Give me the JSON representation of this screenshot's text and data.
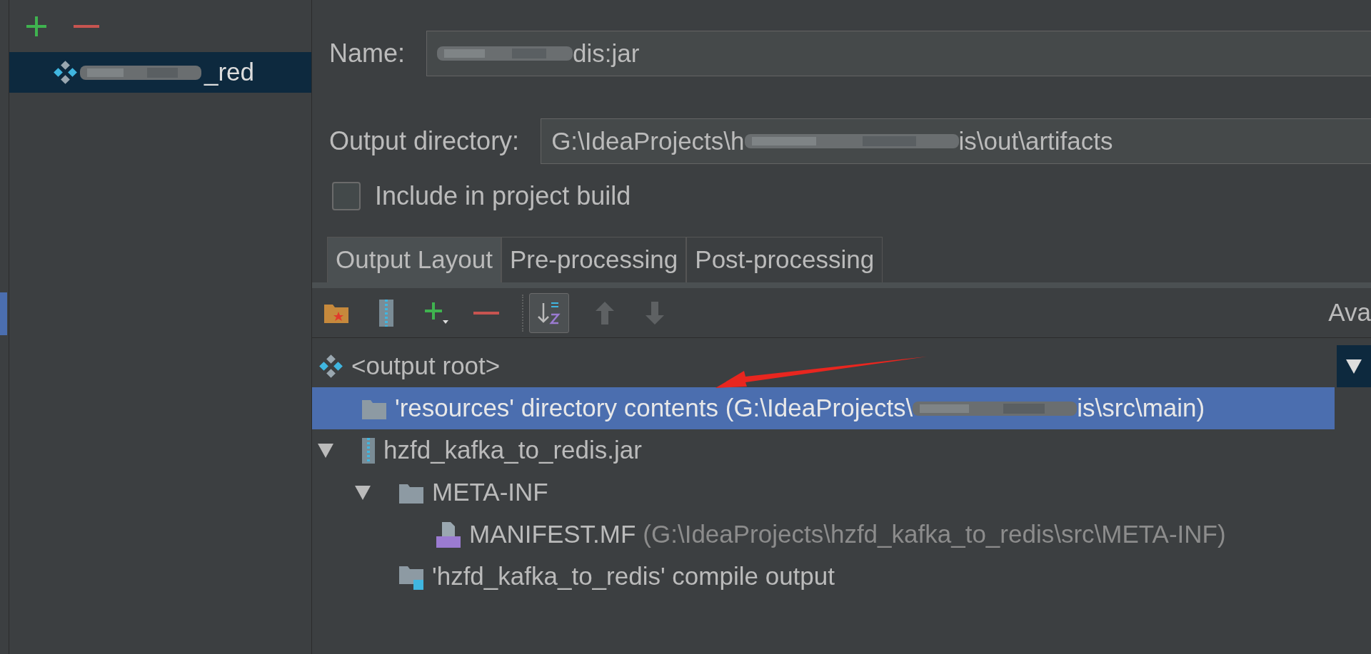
{
  "sidebar": {
    "toolbar": [
      {
        "kind": "add"
      },
      {
        "kind": "remove"
      }
    ],
    "items": [
      {
        "segments": [
          {
            "kind": "blurred"
          },
          {
            "kind": "text",
            "text": "_red"
          }
        ],
        "selected": true
      }
    ]
  },
  "name_field": {
    "label": "Name:",
    "segments": [
      {
        "kind": "blurred"
      },
      {
        "kind": "text",
        "text": "dis:jar"
      }
    ]
  },
  "output_directory": {
    "label": "Output directory:",
    "segments": [
      {
        "kind": "text",
        "text": "G:\\IdeaProjects\\h"
      },
      {
        "kind": "blurred"
      },
      {
        "kind": "text",
        "text": "is\\out\\artifacts"
      }
    ]
  },
  "include_in_build": {
    "label": "Include in project build",
    "checked": false
  },
  "tabs": [
    {
      "label": "Output Layout",
      "selected": true
    },
    {
      "label": "Pre-processing",
      "selected": false
    },
    {
      "label": "Post-processing",
      "selected": false
    }
  ],
  "layout_toolbar": [
    {
      "kind": "new-folder",
      "disabled": false
    },
    {
      "kind": "archive",
      "disabled": false
    },
    {
      "kind": "add",
      "disabled": false
    },
    {
      "kind": "remove",
      "disabled": false
    },
    {
      "kind": "sort",
      "pressed": true,
      "disabled": false
    },
    {
      "kind": "up",
      "disabled": true
    },
    {
      "kind": "down",
      "disabled": true
    }
  ],
  "available_label": "Ava",
  "tree": [
    {
      "kind": "root",
      "segments": [
        {
          "kind": "text",
          "text": "<output root>"
        }
      ],
      "selected": false,
      "children": [
        {
          "kind": "folder",
          "segments": [
            {
              "kind": "text",
              "text": "'resources' directory contents (G:\\IdeaProjects\\"
            },
            {
              "kind": "blurred"
            },
            {
              "kind": "text",
              "text": "is\\src\\main)"
            }
          ],
          "selected": true
        },
        {
          "kind": "jar",
          "segments": [
            {
              "kind": "text",
              "text": "hzfd_kafka_to_redis.jar"
            }
          ],
          "expanded": true,
          "selected": false,
          "children": [
            {
              "kind": "folder",
              "segments": [
                {
                  "kind": "text",
                  "text": "META-INF"
                }
              ],
              "expanded": true,
              "selected": false,
              "children": [
                {
                  "kind": "manifest",
                  "segments": [
                    {
                      "kind": "text",
                      "text": "MANIFEST.MF"
                    }
                  ],
                  "detail": "(G:\\IdeaProjects\\hzfd_kafka_to_redis\\src\\META-INF)",
                  "selected": false
                }
              ]
            },
            {
              "kind": "module-output",
              "segments": [
                {
                  "kind": "text",
                  "text": "'hzfd_kafka_to_redis' compile output"
                }
              ],
              "selected": false
            }
          ]
        }
      ]
    }
  ],
  "available_tree": {
    "expanded": true
  }
}
